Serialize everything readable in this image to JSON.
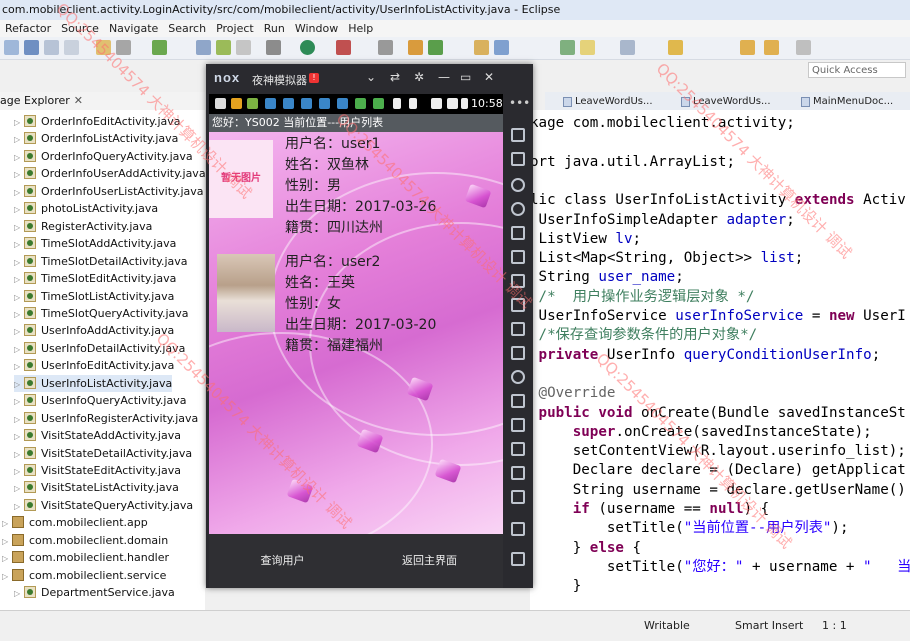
{
  "window": {
    "title": "com.mobileclient.activity.LoginActivity/src/com/mobileclient/activity/UserInfoListActivity.java - Eclipse"
  },
  "menu": [
    "Refactor",
    "Source",
    "Navigate",
    "Search",
    "Project",
    "Run",
    "Window",
    "Help"
  ],
  "quick_access": {
    "placeholder": "Quick Access"
  },
  "package_explorer": {
    "title": "age Explorer",
    "close": "✕",
    "items": [
      {
        "label": "OrderInfoEditActivity.java",
        "type": "file"
      },
      {
        "label": "OrderInfoListActivity.java",
        "type": "file"
      },
      {
        "label": "OrderInfoQueryActivity.java",
        "type": "file"
      },
      {
        "label": "OrderInfoUserAddActivity.java",
        "type": "file"
      },
      {
        "label": "OrderInfoUserListActivity.java",
        "type": "file"
      },
      {
        "label": "photoListActivity.java",
        "type": "file"
      },
      {
        "label": "RegisterActivity.java",
        "type": "file"
      },
      {
        "label": "TimeSlotAddActivity.java",
        "type": "file"
      },
      {
        "label": "TimeSlotDetailActivity.java",
        "type": "file"
      },
      {
        "label": "TimeSlotEditActivity.java",
        "type": "file"
      },
      {
        "label": "TimeSlotListActivity.java",
        "type": "file"
      },
      {
        "label": "TimeSlotQueryActivity.java",
        "type": "file"
      },
      {
        "label": "UserInfoAddActivity.java",
        "type": "file"
      },
      {
        "label": "UserInfoDetailActivity.java",
        "type": "file"
      },
      {
        "label": "UserInfoEditActivity.java",
        "type": "file"
      },
      {
        "label": "UserInfoListActivity.java",
        "type": "file"
      },
      {
        "label": "UserInfoQueryActivity.java",
        "type": "file"
      },
      {
        "label": "UserInfoRegisterActivity.java",
        "type": "file"
      },
      {
        "label": "VisitStateAddActivity.java",
        "type": "file"
      },
      {
        "label": "VisitStateDetailActivity.java",
        "type": "file"
      },
      {
        "label": "VisitStateEditActivity.java",
        "type": "file"
      },
      {
        "label": "VisitStateListActivity.java",
        "type": "file"
      },
      {
        "label": "VisitStateQueryActivity.java",
        "type": "file"
      },
      {
        "label": "com.mobileclient.app",
        "type": "package"
      },
      {
        "label": "com.mobileclient.domain",
        "type": "package"
      },
      {
        "label": "com.mobileclient.handler",
        "type": "package"
      },
      {
        "label": "com.mobileclient.service",
        "type": "package"
      },
      {
        "label": "DepartmentService.java",
        "type": "file"
      }
    ]
  },
  "editor_tabs": [
    "LeaveWordUs...",
    "LeaveWordUs...",
    "MainMenuDoc..."
  ],
  "code": [
    "kage com.mobileclient.activity;",
    "",
    "ort java.util.ArrayList;",
    "",
    "lic class UserInfoListActivity extends Activ",
    " UserInfoSimpleAdapter adapter;",
    " ListView lv;",
    " List<Map<String, Object>> list;",
    " String user_name;",
    " /*  用户操作业务逻辑层对象 */",
    " UserInfoService userInfoService = new UserI",
    " /*保存查询参数条件的用户对象*/",
    " private UserInfo queryConditionUserInfo;",
    "",
    " @Override",
    " public void onCreate(Bundle savedInstanceSt",
    "     super.onCreate(savedInstanceState);",
    "     setContentView(R.layout.userinfo_list);",
    "     Declare declare = (Declare) getApplicat",
    "     String username = declare.getUserName()",
    "     if (username == null) {",
    "         setTitle(\"当前位置--用户列表\");",
    "     } else {",
    "         setTitle(\"您好：\" + username + \"   当",
    "     }"
  ],
  "status": {
    "writable": "Writable",
    "insert": "Smart Insert",
    "position": "1 : 1"
  },
  "emulator": {
    "logo": "nox",
    "name": "夜神模拟器",
    "badge": "!",
    "clock": "10:58",
    "app_title": "您好：YS002   当前位置---用户列表",
    "users": [
      {
        "photo_text": "暂无图片",
        "username": "用户名：user1",
        "name": "姓名：双鱼林",
        "gender": "性别：男",
        "birth": "出生日期：2017-03-26",
        "native": "籍贯：四川达州"
      },
      {
        "photo_text": "",
        "username": "用户名：user2",
        "name": "姓名：王英",
        "gender": "性别：女",
        "birth": "出生日期：2017-03-20",
        "native": "籍贯：福建福州"
      }
    ],
    "buttons": {
      "query": "查询用户",
      "back": "返回主界面"
    }
  },
  "watermark": "QQ:2545404574 大神计算机设计 调试"
}
